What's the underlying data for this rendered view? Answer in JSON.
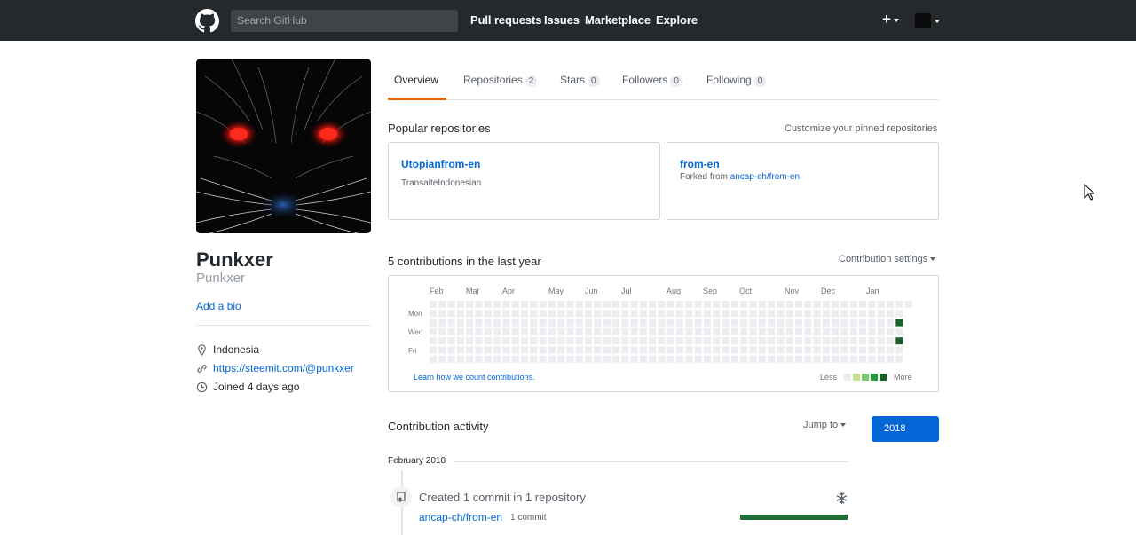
{
  "header": {
    "search_placeholder": "Search GitHub",
    "nav": [
      "Pull requests",
      "Issues",
      "Marketplace",
      "Explore"
    ],
    "plus": "+"
  },
  "profile": {
    "name": "Punkxer",
    "login": "Punkxer",
    "add_bio": "Add a bio",
    "location": "Indonesia",
    "website": "https://steemit.com/@punkxer",
    "joined": "Joined 4 days ago"
  },
  "tabs": [
    {
      "label": "Overview",
      "count": ""
    },
    {
      "label": "Repositories",
      "count": "2"
    },
    {
      "label": "Stars",
      "count": "0"
    },
    {
      "label": "Followers",
      "count": "0"
    },
    {
      "label": "Following",
      "count": "0"
    }
  ],
  "popular": {
    "title": "Popular repositories",
    "customize": "Customize your pinned repositories",
    "repos": [
      {
        "name": "Utopianfrom-en",
        "desc": "TransalteIndonesian",
        "forked_prefix": "",
        "forked_from": ""
      },
      {
        "name": "from-en",
        "desc": "",
        "forked_prefix": "Forked from ",
        "forked_from": "ancap-ch/from-en"
      }
    ]
  },
  "contributions": {
    "title": "5 contributions in the last year",
    "settings": "Contribution settings",
    "months": [
      "Feb",
      "Mar",
      "Apr",
      "May",
      "Jun",
      "Jul",
      "Aug",
      "Sep",
      "Oct",
      "Nov",
      "Dec",
      "Jan"
    ],
    "weekdays": [
      "Mon",
      "Wed",
      "Fri"
    ],
    "learn": "Learn how we count contributions.",
    "less": "Less",
    "more": "More",
    "colors": [
      "#ebedf0",
      "#c6e48b",
      "#7bc96f",
      "#239a3b",
      "#196127"
    ]
  },
  "activity": {
    "title": "Contribution activity",
    "jump": "Jump to",
    "year": "2018",
    "month": "February 2018",
    "item_title": "Created 1 commit in 1 repository",
    "repo": "ancap-ch/from-en",
    "count": "1 commit",
    "bar_fraction": 1.0
  }
}
